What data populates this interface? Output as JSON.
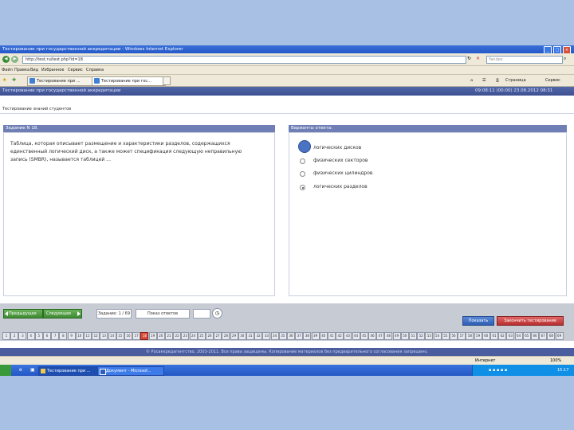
{
  "window": {
    "title": "Тестирование при государственной аккредитации - Windows Internet Explorer",
    "controls": [
      "_",
      "□",
      "×"
    ]
  },
  "address": {
    "url": "http://test.ru/test.php?id=18",
    "search_placeholder": "Yandex"
  },
  "menu": [
    "Файл",
    "Правка",
    "Вид",
    "Избранное",
    "Сервис",
    "Справка"
  ],
  "tabs": [
    {
      "label": "Тестирование при ..."
    },
    {
      "label": "Тестирование при гос..."
    }
  ],
  "toolbar": {
    "page": "Страница",
    "service": "Сервис"
  },
  "page": {
    "header": "Тестирование при государственной аккредитации",
    "timer": "09:08:11 (00:00) 23.08.2012 08:31",
    "subheader": "Тестирование знаний студентов"
  },
  "question_panel": {
    "title": "Задание N 18.",
    "text": "Таблица, которая описывает размещение и характеристики разделов, содержащихся единственный логический диск, а также может спецификация следующую неправильную запись (SMBR), называется таблицей …"
  },
  "answers_panel": {
    "title": "Варианты ответа:",
    "options": [
      {
        "label": "логических дисков",
        "selected": false
      },
      {
        "label": "физических секторов",
        "selected": false
      },
      {
        "label": "физических цилиндров",
        "selected": false
      },
      {
        "label": "логических разделов",
        "selected": true
      }
    ]
  },
  "navigation": {
    "prev": "Предыдущее",
    "next": "Следующее",
    "task_counter": "Задание: 1 / 69",
    "show_answered": "Показ ответов",
    "blank_field": "",
    "finish": "Показать",
    "end_test": "Закончить тестирование"
  },
  "task_numbers": [
    "1",
    "2",
    "3",
    "4",
    "5",
    "6",
    "7",
    "8",
    "9",
    "10",
    "11",
    "12",
    "13",
    "14",
    "15",
    "16",
    "17",
    "18",
    "19",
    "20",
    "21",
    "22",
    "23",
    "24",
    "25",
    "26",
    "27",
    "28",
    "29",
    "30",
    "31",
    "32",
    "33",
    "34",
    "35",
    "36",
    "37",
    "38",
    "39",
    "40",
    "41",
    "42",
    "43",
    "44",
    "45",
    "46",
    "47",
    "48",
    "49",
    "50",
    "51",
    "52",
    "53",
    "54",
    "55",
    "56",
    "57",
    "58",
    "59",
    "60",
    "61",
    "62",
    "63",
    "64",
    "65",
    "66",
    "67",
    "68",
    "69"
  ],
  "current_task": 18,
  "footer": "© Росаккредагентство, 2003-2011. Все права защищены. Копирование материалов без предварительного согласования запрещено.",
  "statusbar": {
    "zone": "Интернет",
    "zoom": "100%"
  },
  "taskbar": [
    {
      "label": "Тестирование при ..."
    },
    {
      "label": "Документ - Microsof..."
    }
  ],
  "clock": "15:17",
  "colors": {
    "accent": "#4a5d9e",
    "selected_task": "#d84a3a",
    "next_button": "#3f8a33"
  }
}
